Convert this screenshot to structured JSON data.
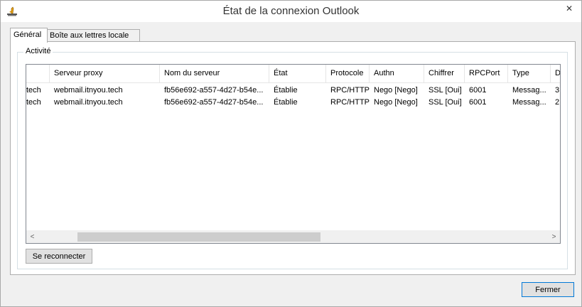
{
  "window": {
    "title": "État de la connexion Outlook",
    "close_glyph": "✕"
  },
  "tabs": [
    {
      "label": "Général"
    },
    {
      "label": "Boîte aux lettres locale"
    }
  ],
  "groupbox": {
    "label": "Activité"
  },
  "table": {
    "columns": [
      "",
      "Serveur proxy",
      "Nom du serveur",
      "État",
      "Protocole",
      "Authn",
      "Chiffrer",
      "RPCPort",
      "Type",
      "D"
    ],
    "rows": [
      [
        "tech",
        "webmail.itnyou.tech",
        "fb56e692-a557-4d27-b54e...",
        "Établie",
        "RPC/HTTP",
        "Nego [Nego]",
        "SSL [Oui]",
        "6001",
        "Messag...",
        "3"
      ],
      [
        "tech",
        "webmail.itnyou.tech",
        "fb56e692-a557-4d27-b54e...",
        "Établie",
        "RPC/HTTP",
        "Nego [Nego]",
        "SSL [Oui]",
        "6001",
        "Messag...",
        "2"
      ]
    ]
  },
  "scrollbar": {
    "left_glyph": "<",
    "right_glyph": ">"
  },
  "buttons": {
    "reconnect": "Se reconnecter",
    "close": "Fermer"
  }
}
